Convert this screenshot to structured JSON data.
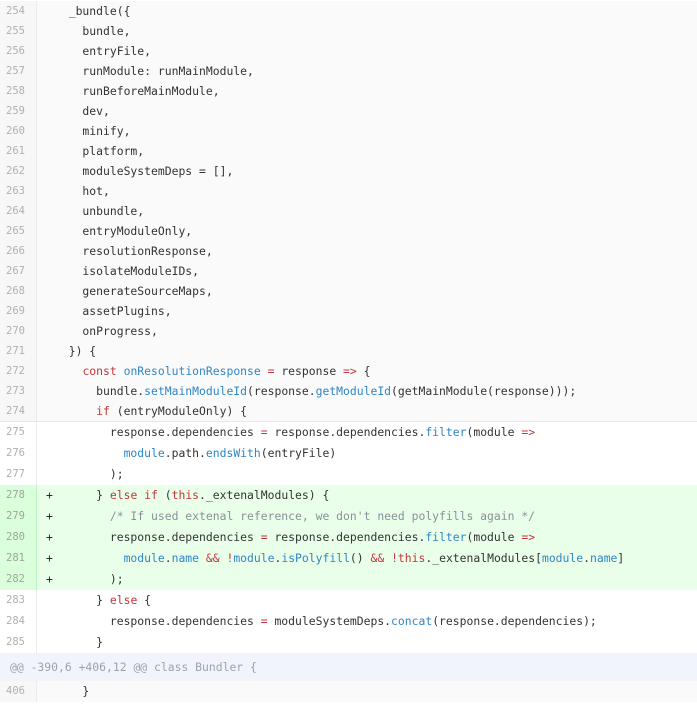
{
  "diff": {
    "section1": [
      {
        "num": "254",
        "code": "  _bundle({"
      },
      {
        "num": "255",
        "code": "    bundle,"
      },
      {
        "num": "256",
        "code": "    entryFile,"
      },
      {
        "num": "257",
        "code": "    runModule: runMainModule,"
      },
      {
        "num": "258",
        "code": "    runBeforeMainModule,"
      },
      {
        "num": "259",
        "code": "    dev,"
      },
      {
        "num": "260",
        "code": "    minify,"
      },
      {
        "num": "261",
        "code": "    platform,"
      },
      {
        "num": "262",
        "code": "    moduleSystemDeps = [],"
      },
      {
        "num": "263",
        "code": "    hot,"
      },
      {
        "num": "264",
        "code": "    unbundle,"
      },
      {
        "num": "265",
        "code": "    entryModuleOnly,"
      },
      {
        "num": "266",
        "code": "    resolutionResponse,"
      },
      {
        "num": "267",
        "code": "    isolateModuleIDs,"
      },
      {
        "num": "268",
        "code": "    generateSourceMaps,"
      },
      {
        "num": "269",
        "code": "    assetPlugins,"
      },
      {
        "num": "270",
        "code": "    onProgress,"
      },
      {
        "num": "271",
        "code": "  }) {"
      },
      {
        "num": "272",
        "code": "    const onResolutionResponse = response => {"
      },
      {
        "num": "273",
        "code": "      bundle.setMainModuleId(response.getModuleId(getMainModule(response)));"
      },
      {
        "num": "274",
        "code": "      if (entryModuleOnly) {"
      }
    ],
    "section2": [
      {
        "num": "275",
        "sign": "",
        "code": "        response.dependencies = response.dependencies.filter(module =>"
      },
      {
        "num": "276",
        "sign": "",
        "code": "          module.path.endsWith(entryFile)"
      },
      {
        "num": "277",
        "sign": "",
        "code": "        );"
      },
      {
        "num": "278",
        "sign": "+",
        "code": "      } else if (this._extenalModules) {"
      },
      {
        "num": "279",
        "sign": "+",
        "code": "        /* If used extenal reference, we don't need polyfills again */"
      },
      {
        "num": "280",
        "sign": "+",
        "code": "        response.dependencies = response.dependencies.filter(module =>"
      },
      {
        "num": "281",
        "sign": "+",
        "code": "          module.name && !module.isPolyfill() && !this._extenalModules[module.name]"
      },
      {
        "num": "282",
        "sign": "+",
        "code": "        );"
      },
      {
        "num": "283",
        "sign": "",
        "code": "      } else {"
      },
      {
        "num": "284",
        "sign": "",
        "code": "        response.dependencies = moduleSystemDeps.concat(response.dependencies);"
      },
      {
        "num": "285",
        "sign": "",
        "code": "      }"
      }
    ],
    "hunk_header": "@@ -390,6 +406,12 @@ class Bundler {",
    "last_line": {
      "num": "406",
      "code": "    }"
    }
  }
}
